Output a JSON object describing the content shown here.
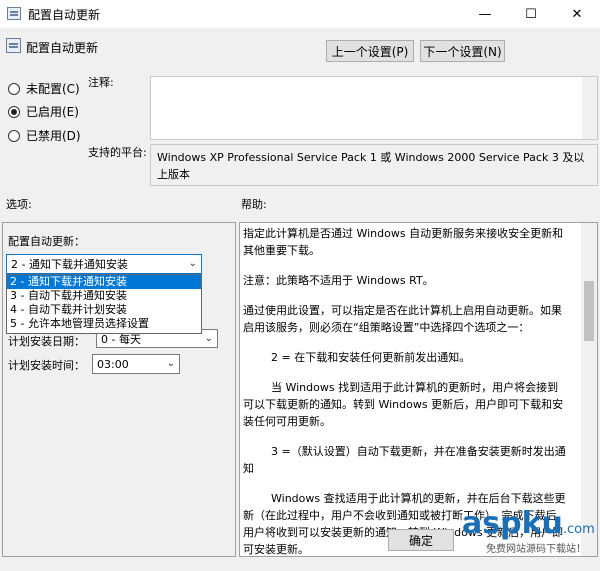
{
  "window": {
    "title": "配置自动更新",
    "minimize_glyph": "—",
    "maximize_glyph": "☐",
    "close_glyph": "✕"
  },
  "header": {
    "policy_name": "配置自动更新",
    "prev_button": "上一个设置(P)",
    "next_button": "下一个设置(N)"
  },
  "state": {
    "not_configured": "未配置(C)",
    "enabled": "已启用(E)",
    "disabled": "已禁用(D)",
    "selected": "enabled"
  },
  "comment": {
    "label": "注释:",
    "value": ""
  },
  "platform": {
    "label": "支持的平台:",
    "value": "Windows XP Professional Service Pack 1 或 Windows 2000 Service Pack 3 及以上版本"
  },
  "options": {
    "label": "选项:",
    "config_label": "配置自动更新：",
    "combo_value": "2 - 通知下载并通知安装",
    "dropdown_items": [
      "2 - 通知下载并通知安装",
      "3 - 自动下载并通知安装",
      "4 - 自动下载并计划安装",
      "5 - 允许本地管理员选择设置"
    ],
    "schedule_day_label": "计划安装日期：",
    "schedule_day_value": "0 - 每天",
    "schedule_time_label": "计划安装时间：",
    "schedule_time_value": "03:00"
  },
  "help": {
    "label": "帮助:",
    "paragraphs": [
      "指定此计算机是否通过 Windows 自动更新服务来接收安全更新和其他重要下载。",
      "注意：此策略不适用于 Windows RT。",
      "通过使用此设置，可以指定是否在此计算机上启用自动更新。如果启用该服务，则必须在“组策略设置”中选择四个选项之一：",
      "2 = 在下载和安装任何更新前发出通知。",
      "当 Windows 找到适用于此计算机的更新时，用户将会接到可以下载更新的通知。转到 Windows 更新后，用户即可下载和安装任何可用更新。",
      "3 =（默认设置）自动下载更新，并在准备安装更新时发出通知",
      "Windows 查找适用于此计算机的更新，并在后台下载这些更新（在此过程中，用户不会收到通知或被打断工作）。完成下载后，用户将收到可以安装更新的通知。转到 Windows 更新后，用户即可安装更新。"
    ]
  },
  "footer": {
    "ok_button": "确定"
  },
  "watermark": {
    "brand": "aspku",
    "suffix": ".com",
    "caption": "免费网站源码下载站！"
  }
}
